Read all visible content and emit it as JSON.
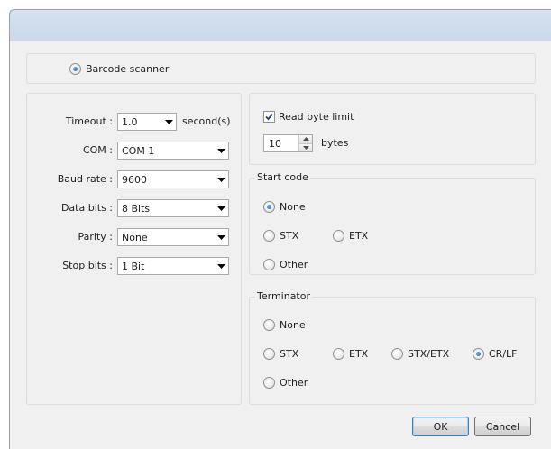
{
  "mode": {
    "label": "Barcode scanner",
    "selected": true
  },
  "settings": {
    "timeout": {
      "label": "Timeout :",
      "value": "1.0",
      "unit": "second(s)"
    },
    "com": {
      "label": "COM :",
      "value": "COM 1"
    },
    "baud_rate": {
      "label": "Baud rate :",
      "value": "9600"
    },
    "data_bits": {
      "label": "Data bits :",
      "value": "8 Bits"
    },
    "parity": {
      "label": "Parity :",
      "value": "None"
    },
    "stop_bits": {
      "label": "Stop bits :",
      "value": "1 Bit"
    }
  },
  "read_limit": {
    "checkbox_label": "Read byte limit",
    "checked": true,
    "value": "10",
    "unit": "bytes"
  },
  "start_code": {
    "title": "Start code",
    "options": [
      {
        "label": "None",
        "selected": true
      },
      {
        "label": "STX",
        "selected": false
      },
      {
        "label": "ETX",
        "selected": false
      },
      {
        "label": "Other",
        "selected": false
      }
    ]
  },
  "terminator": {
    "title": "Terminator",
    "options": [
      {
        "label": "None",
        "selected": false
      },
      {
        "label": "STX",
        "selected": false
      },
      {
        "label": "ETX",
        "selected": false
      },
      {
        "label": "STX/ETX",
        "selected": false
      },
      {
        "label": "CR/LF",
        "selected": true
      },
      {
        "label": "Other",
        "selected": false
      }
    ]
  },
  "buttons": {
    "ok": "OK",
    "cancel": "Cancel"
  },
  "icons": {
    "dropdown": "chevron-down-icon",
    "check": "checkmark-icon",
    "spin_up": "spin-up-icon",
    "spin_down": "spin-down-icon"
  },
  "colors": {
    "titlebar": "#cbd9ea",
    "window_bg": "#f0f0f0",
    "radio_selected": "#1a5db3"
  }
}
